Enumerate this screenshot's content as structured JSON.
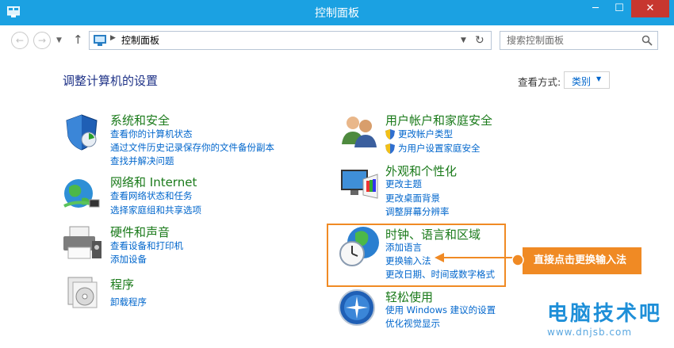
{
  "window": {
    "title": "控制面板",
    "min_glyph": "─",
    "max_glyph": "☐",
    "close_glyph": "✕"
  },
  "address": {
    "path": "控制面板",
    "search_placeholder": "搜索控制面板"
  },
  "header": {
    "title": "调整计算机的设置",
    "view_label": "查看方式:",
    "view_value": "类别"
  },
  "left_column": [
    {
      "title": "系统和安全",
      "icon": "shield-icon",
      "links": [
        "查看你的计算机状态",
        "通过文件历史记录保存你的文件备份副本",
        "查找并解决问题"
      ]
    },
    {
      "title": "网络和 Internet",
      "icon": "network-icon",
      "links": [
        "查看网络状态和任务",
        "选择家庭组和共享选项"
      ]
    },
    {
      "title": "硬件和声音",
      "icon": "printer-icon",
      "links": [
        "查看设备和打印机",
        "添加设备"
      ]
    },
    {
      "title": "程序",
      "icon": "programs-icon",
      "links": [
        "卸载程序"
      ]
    }
  ],
  "right_column": [
    {
      "title": "用户帐户和家庭安全",
      "icon": "users-icon",
      "links": [
        "更改帐户类型",
        "为用户设置家庭安全"
      ]
    },
    {
      "title": "外观和个性化",
      "icon": "appearance-icon",
      "links": [
        "更改主题",
        "更改桌面背景",
        "调整屏幕分辨率"
      ]
    },
    {
      "title": "时钟、语言和区域",
      "icon": "clock-globe-icon",
      "links": [
        "添加语言",
        "更换输入法",
        "更改日期、时间或数字格式"
      ]
    },
    {
      "title": "轻松使用",
      "icon": "ease-of-access-icon",
      "links": [
        "使用 Windows 建议的设置",
        "优化视觉显示"
      ]
    }
  ],
  "annotation": {
    "text": "直接点击更换输入法"
  },
  "watermark": {
    "text": "电脑技术吧",
    "url": "www.dnjsb.com"
  },
  "colors": {
    "titlebar": "#1ba1e2",
    "accent": "#f08a24",
    "link": "#0066cc",
    "category": "#1a7a1a"
  }
}
